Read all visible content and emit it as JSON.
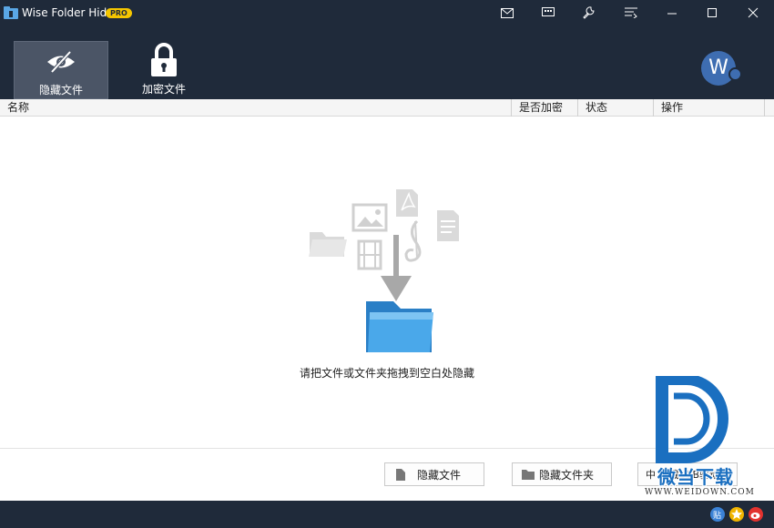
{
  "window": {
    "title": "Wise Folder Hider",
    "badge": "PRO",
    "controls": [
      "mail-icon",
      "feedback-icon",
      "settings-icon",
      "menu-icon",
      "minimize-icon",
      "maximize-icon",
      "close-icon"
    ]
  },
  "toolbar": {
    "tools": [
      {
        "label": "隐藏文件",
        "icon": "eye-slash-icon",
        "active": true
      },
      {
        "label": "加密文件",
        "icon": "lock-icon",
        "active": false
      }
    ],
    "avatar_letter": "W"
  },
  "table": {
    "columns": [
      "名称",
      "是否加密",
      "状态",
      "操作"
    ],
    "rows": []
  },
  "drop_area": {
    "hint": "请把文件或文件夹拖拽到空白处隐藏"
  },
  "buttons": {
    "hide_file": "隐藏文件",
    "hide_folder": "隐藏文件夹",
    "hide_usb": "中 隐藏USB驱动器"
  },
  "watermark": {
    "text": "微当下载",
    "url": "WWW.WEIDOWN.COM"
  },
  "colors": {
    "chrome": "#1f2a3a",
    "active_tool": "#4b5566",
    "badge": "#f5c600",
    "avatar": "#3e6db1",
    "folder": "#3d9ee0"
  }
}
